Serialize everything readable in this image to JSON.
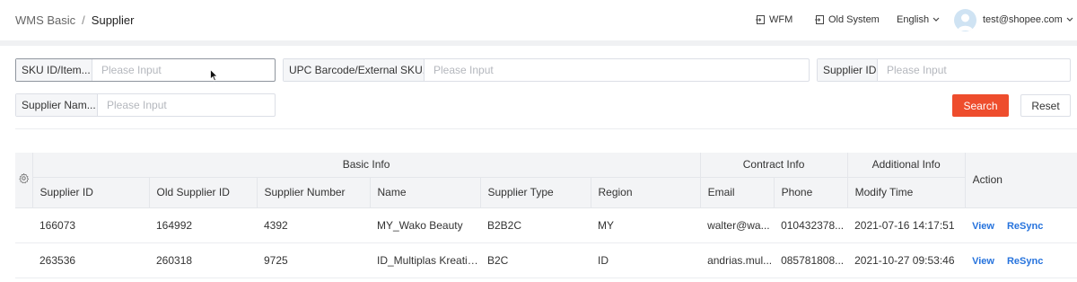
{
  "header": {
    "breadcrumb_root": "WMS Basic",
    "breadcrumb_sep": "/",
    "breadcrumb_current": "Supplier",
    "wfm_label": "WFM",
    "old_system_label": "Old System",
    "language_label": "English",
    "user_email": "test@shopee.com"
  },
  "filters": {
    "sku": {
      "label": "SKU ID/Item...",
      "placeholder": "Please Input"
    },
    "upc": {
      "label": "UPC Barcode/External SKU...",
      "placeholder": "Please Input"
    },
    "supplier_id": {
      "label": "Supplier ID",
      "placeholder": "Please Input"
    },
    "supplier_name": {
      "label": "Supplier Nam...",
      "placeholder": "Please Input"
    },
    "search_label": "Search",
    "reset_label": "Reset"
  },
  "table": {
    "groups": {
      "basic": "Basic Info",
      "contract": "Contract Info",
      "additional": "Additional Info",
      "action": "Action"
    },
    "columns": [
      "Supplier ID",
      "Old Supplier ID",
      "Supplier Number",
      "Name",
      "Supplier Type",
      "Region",
      "Email",
      "Phone",
      "Modify Time"
    ],
    "rows": [
      {
        "cells": [
          "166073",
          "164992",
          "4392",
          "MY_Wako Beauty",
          "B2B2C",
          "MY",
          "walter@wa...",
          "010432378...",
          "2021-07-16 14:17:51"
        ],
        "view": "View",
        "resync": "ReSync"
      },
      {
        "cells": [
          "263536",
          "260318",
          "9725",
          "ID_Multiplas Kreatif ...",
          "B2C",
          "ID",
          "andrias.mul...",
          "085781808...",
          "2021-10-27 09:53:46"
        ],
        "view": "View",
        "resync": "ReSync"
      }
    ]
  }
}
